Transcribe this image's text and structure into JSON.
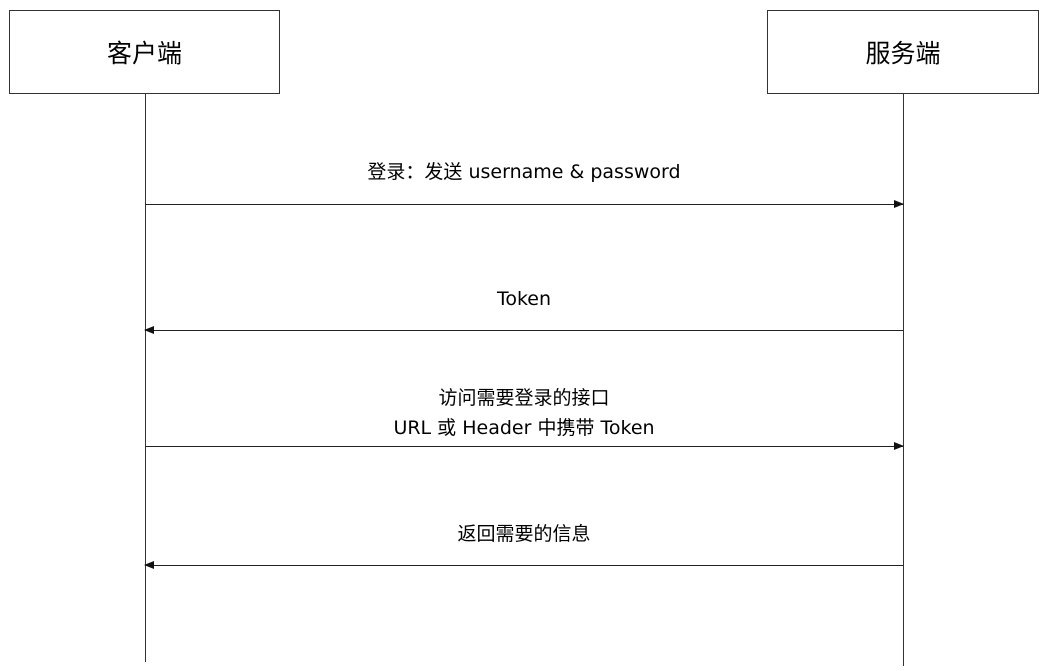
{
  "actors": {
    "client": "客户端",
    "server": "服务端"
  },
  "messages": [
    {
      "from": "client",
      "to": "server",
      "lines": [
        "登录：发送 username & password"
      ]
    },
    {
      "from": "server",
      "to": "client",
      "lines": [
        "Token"
      ]
    },
    {
      "from": "client",
      "to": "server",
      "lines": [
        "访问需要登录的接口",
        "URL 或 Header 中携带 Token"
      ]
    },
    {
      "from": "server",
      "to": "client",
      "lines": [
        "返回需要的信息"
      ]
    }
  ]
}
